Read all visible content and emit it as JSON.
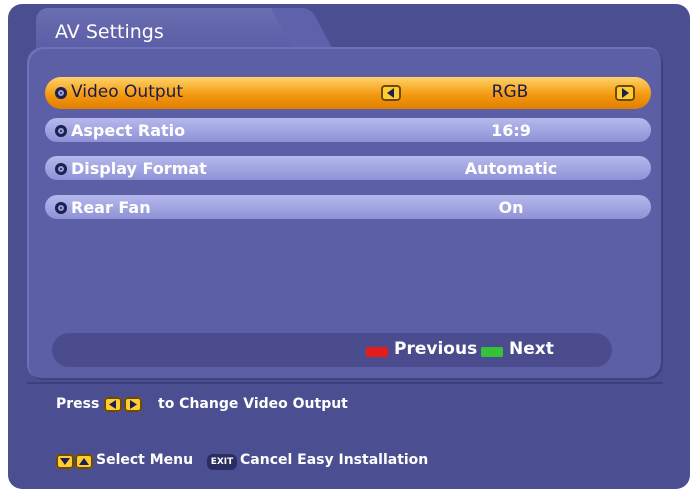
{
  "window": {
    "tab_title": "AV Settings"
  },
  "settings": [
    {
      "label": "Video Output",
      "value": "RGB",
      "selected": true
    },
    {
      "label": "Aspect Ratio",
      "value": "16:9",
      "selected": false
    },
    {
      "label": "Display Format",
      "value": "Automatic",
      "selected": false
    },
    {
      "label": "Rear Fan",
      "value": "On",
      "selected": false
    }
  ],
  "nav": {
    "previous_label": "Previous",
    "next_label": "Next",
    "previous_color": "#e51c1c",
    "next_color": "#34c23a"
  },
  "hints": {
    "press_label": "Press",
    "change_label": "to Change Video Output",
    "select_menu_label": "Select Menu",
    "exit_key_label": "EXIT",
    "cancel_label": "Cancel Easy Installation"
  },
  "colors": {
    "background": "#4c4e92",
    "selected_row": "#f49a10",
    "row": "#a7aae4",
    "key_button": "#ffcc33"
  }
}
